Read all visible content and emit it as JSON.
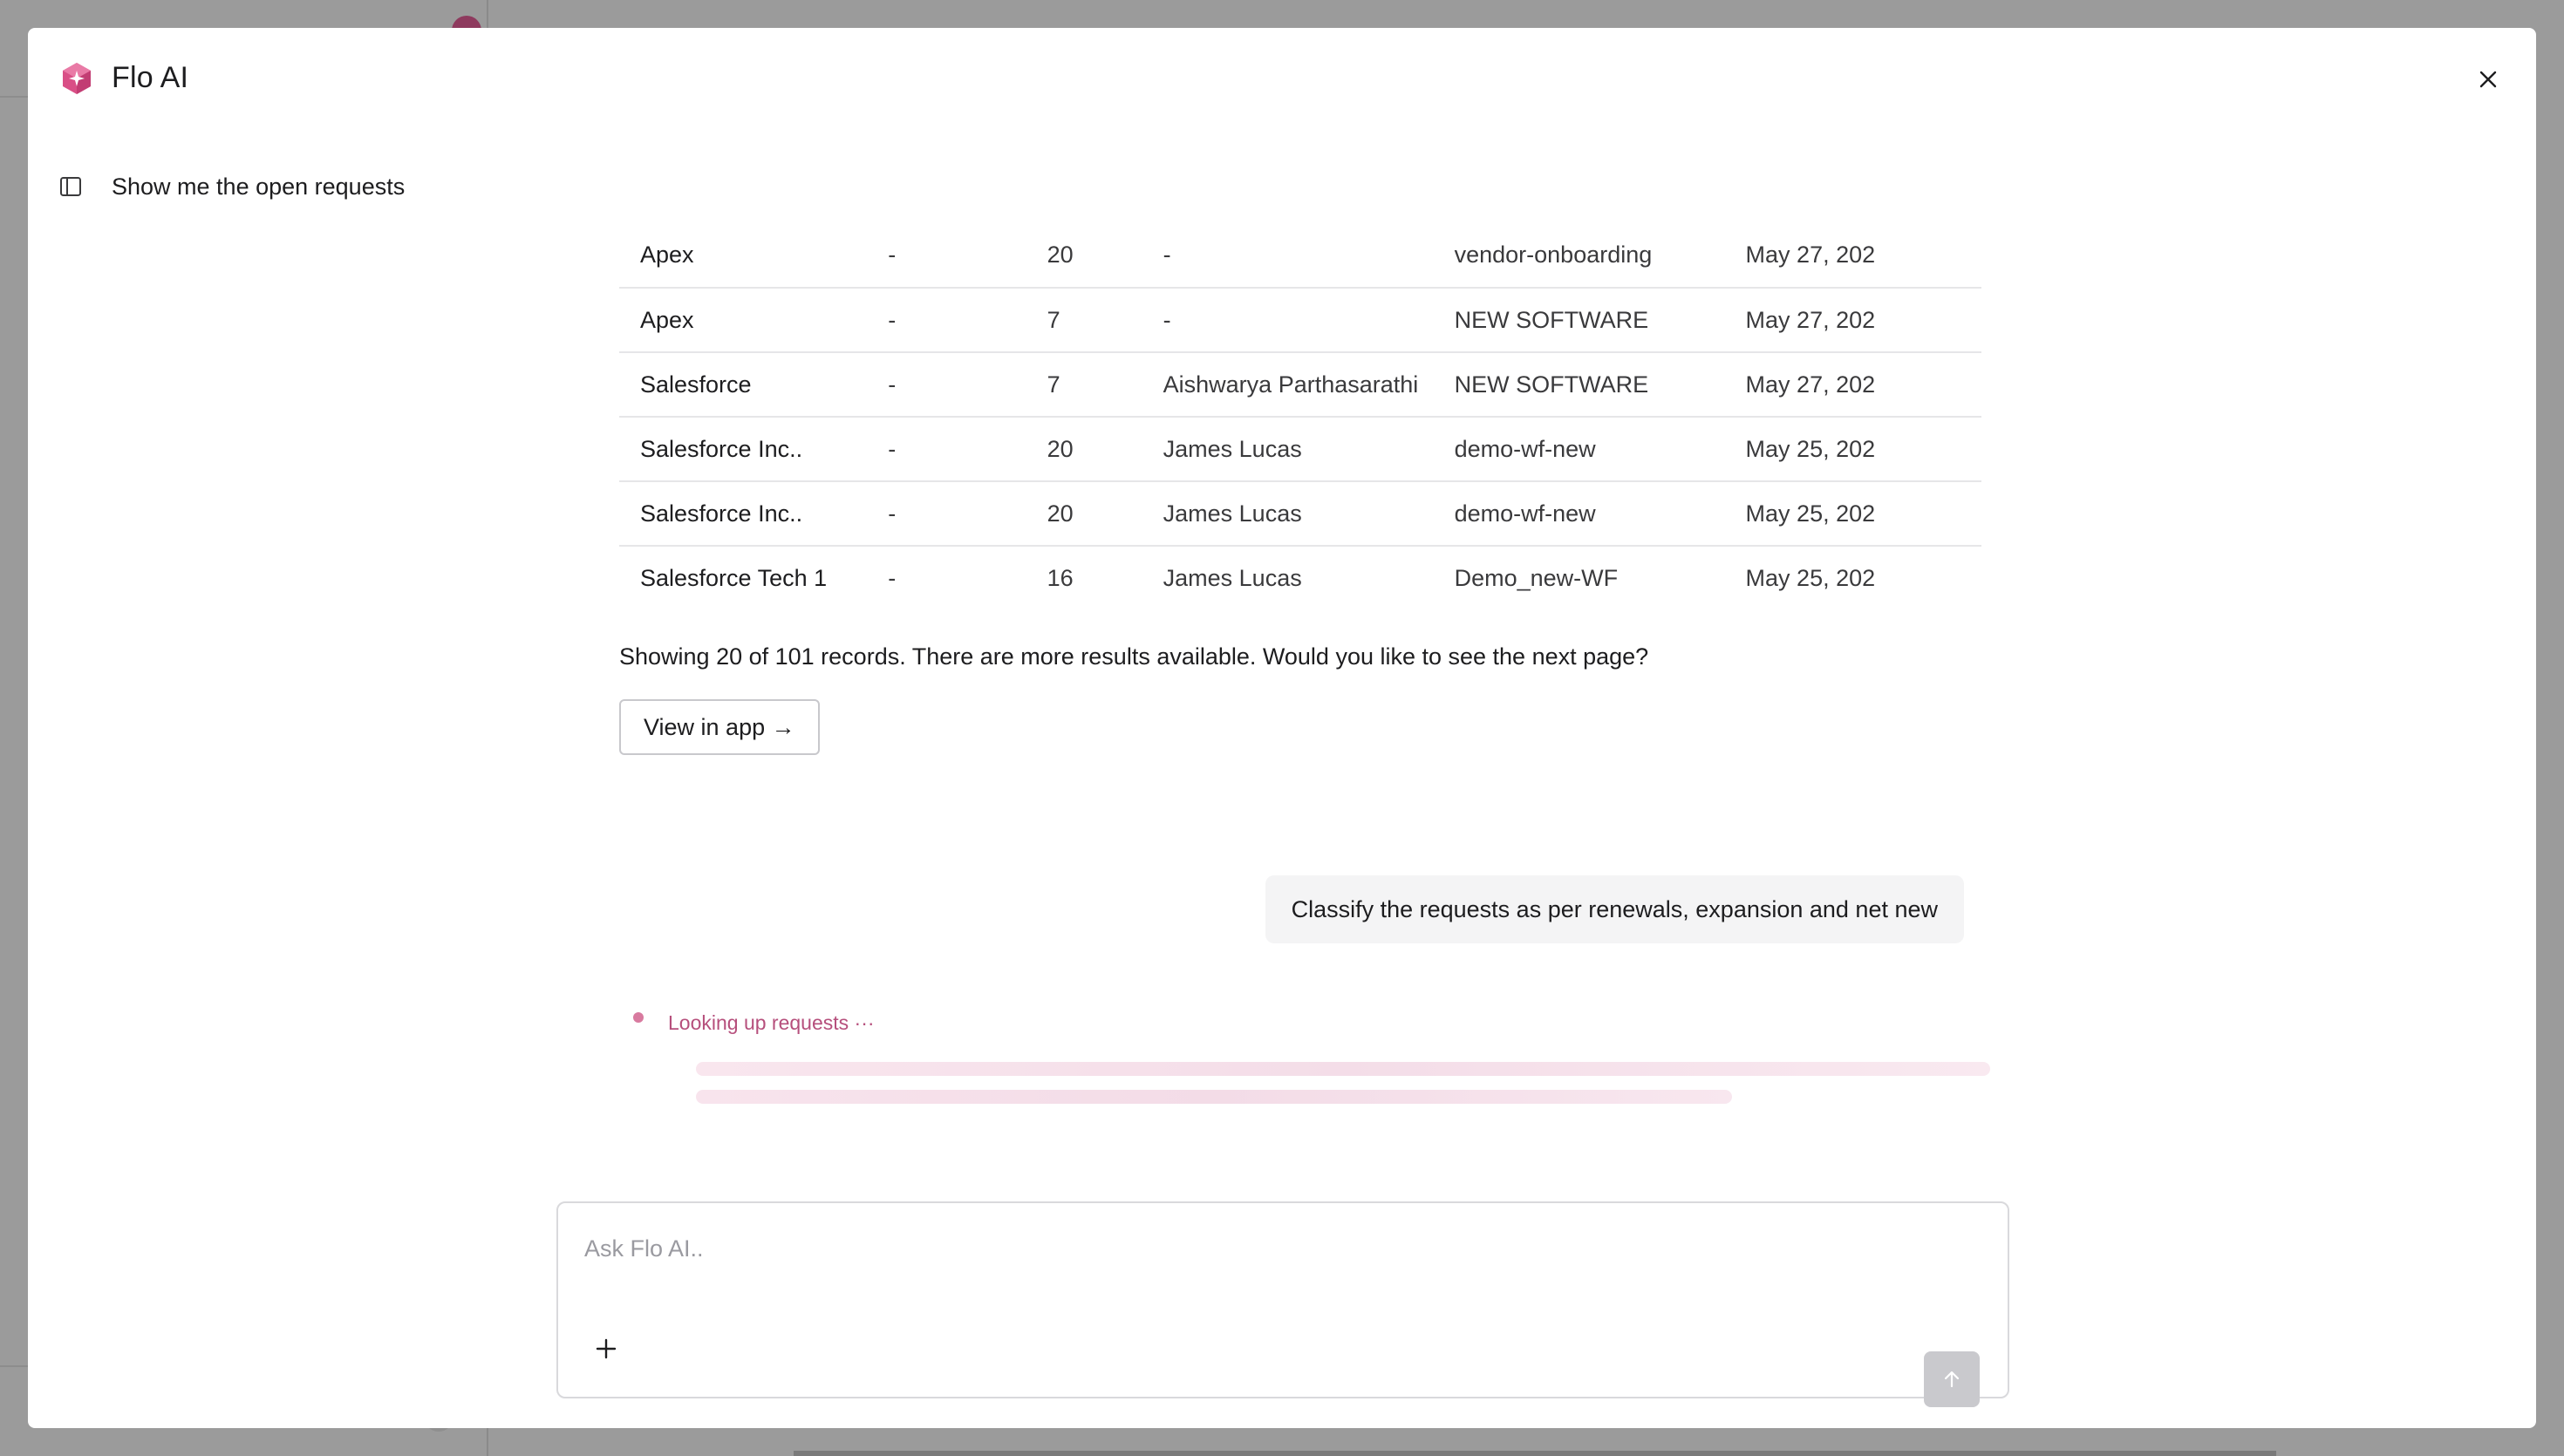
{
  "modal": {
    "title": "Flo AI",
    "close_icon": "close-icon",
    "logo_icon": "flo-ai-logo-icon"
  },
  "thread": {
    "panel_icon": "sidebar-toggle-icon",
    "title": "Show me the open requests"
  },
  "results": {
    "rows": [
      [
        "Apex",
        "-",
        "20",
        "-",
        "vendor-onboarding",
        "May 27, 202"
      ],
      [
        "Apex",
        "-",
        "7",
        "-",
        "NEW SOFTWARE",
        "May 27, 202"
      ],
      [
        "Salesforce",
        "-",
        "7",
        "Aishwarya Parthasarathi",
        "NEW SOFTWARE",
        "May 27, 202"
      ],
      [
        "Salesforce Inc..",
        "-",
        "20",
        "James Lucas",
        "demo-wf-new",
        "May 25, 202"
      ],
      [
        "Salesforce Inc..",
        "-",
        "20",
        "James Lucas",
        "demo-wf-new",
        "May 25, 202"
      ],
      [
        "Salesforce Tech 1",
        "-",
        "16",
        "James Lucas",
        "Demo_new-WF",
        "May 25, 202"
      ]
    ],
    "summary": "Showing 20 of 101 records. There are more results available. Would you like to see the next page?",
    "view_button": "View in app →"
  },
  "user_message": "Classify the requests as per renewals, expansion and net new",
  "status": {
    "text": "Looking up requests ···",
    "accent_color": "#b64f7c"
  },
  "composer": {
    "placeholder": "Ask Flo AI..",
    "value": "",
    "plus_icon": "plus-icon",
    "send_icon": "arrow-up-icon"
  },
  "colors": {
    "accent_pink": "#d94f86",
    "overlay": "#9b9b9b",
    "send_disabled": "#c9c9cd"
  }
}
